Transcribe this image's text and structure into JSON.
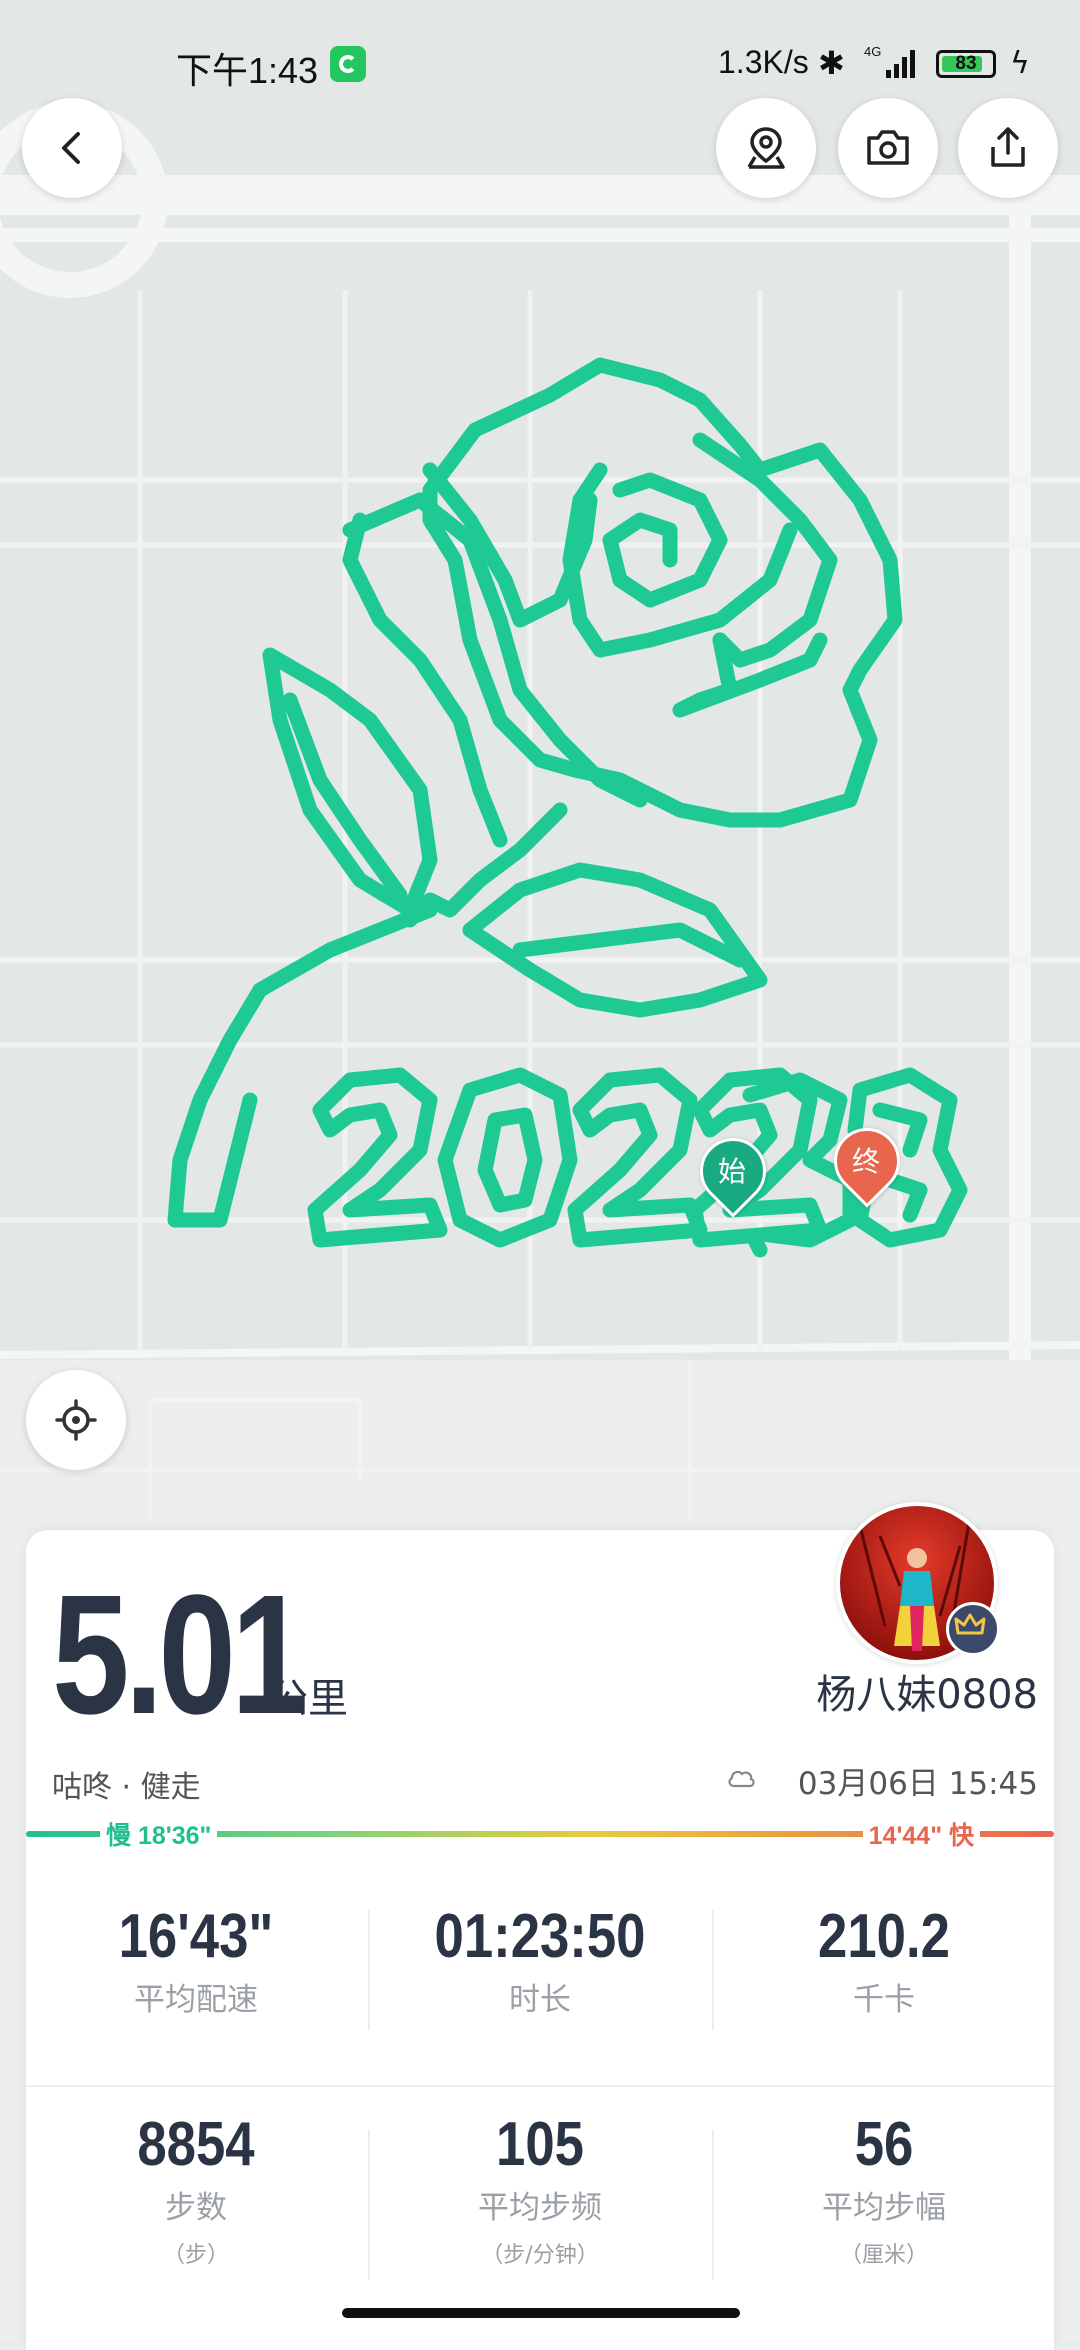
{
  "status_bar": {
    "time": "下午1:43",
    "net_speed": "1.3K/s",
    "battery": "83",
    "battery_level": 0.83
  },
  "map": {
    "start_marker": "始",
    "end_marker": "终",
    "route_color": "#1fc993"
  },
  "toolbar": {
    "back": "back-arrow-icon",
    "poi": "location-pin-icon",
    "camera": "camera-icon",
    "share": "share-icon",
    "locate": "locate-icon"
  },
  "summary": {
    "distance": "5.01",
    "unit": "公里",
    "activity": "咕咚 · 健走",
    "username": "杨八妹0808",
    "datetime": "03月06日 15:45"
  },
  "pace": {
    "slow": "慢 18'36\"",
    "fast": "14'44\" 快"
  },
  "stats": [
    {
      "value": "16'43\"",
      "label": "平均配速",
      "sub": ""
    },
    {
      "value": "01:23:50",
      "label": "时长",
      "sub": ""
    },
    {
      "value": "210.2",
      "label": "千卡",
      "sub": ""
    },
    {
      "value": "8854",
      "label": "步数",
      "sub": "（步）"
    },
    {
      "value": "105",
      "label": "平均步频",
      "sub": "（步/分钟）"
    },
    {
      "value": "56",
      "label": "平均步幅",
      "sub": "（厘米）"
    }
  ]
}
